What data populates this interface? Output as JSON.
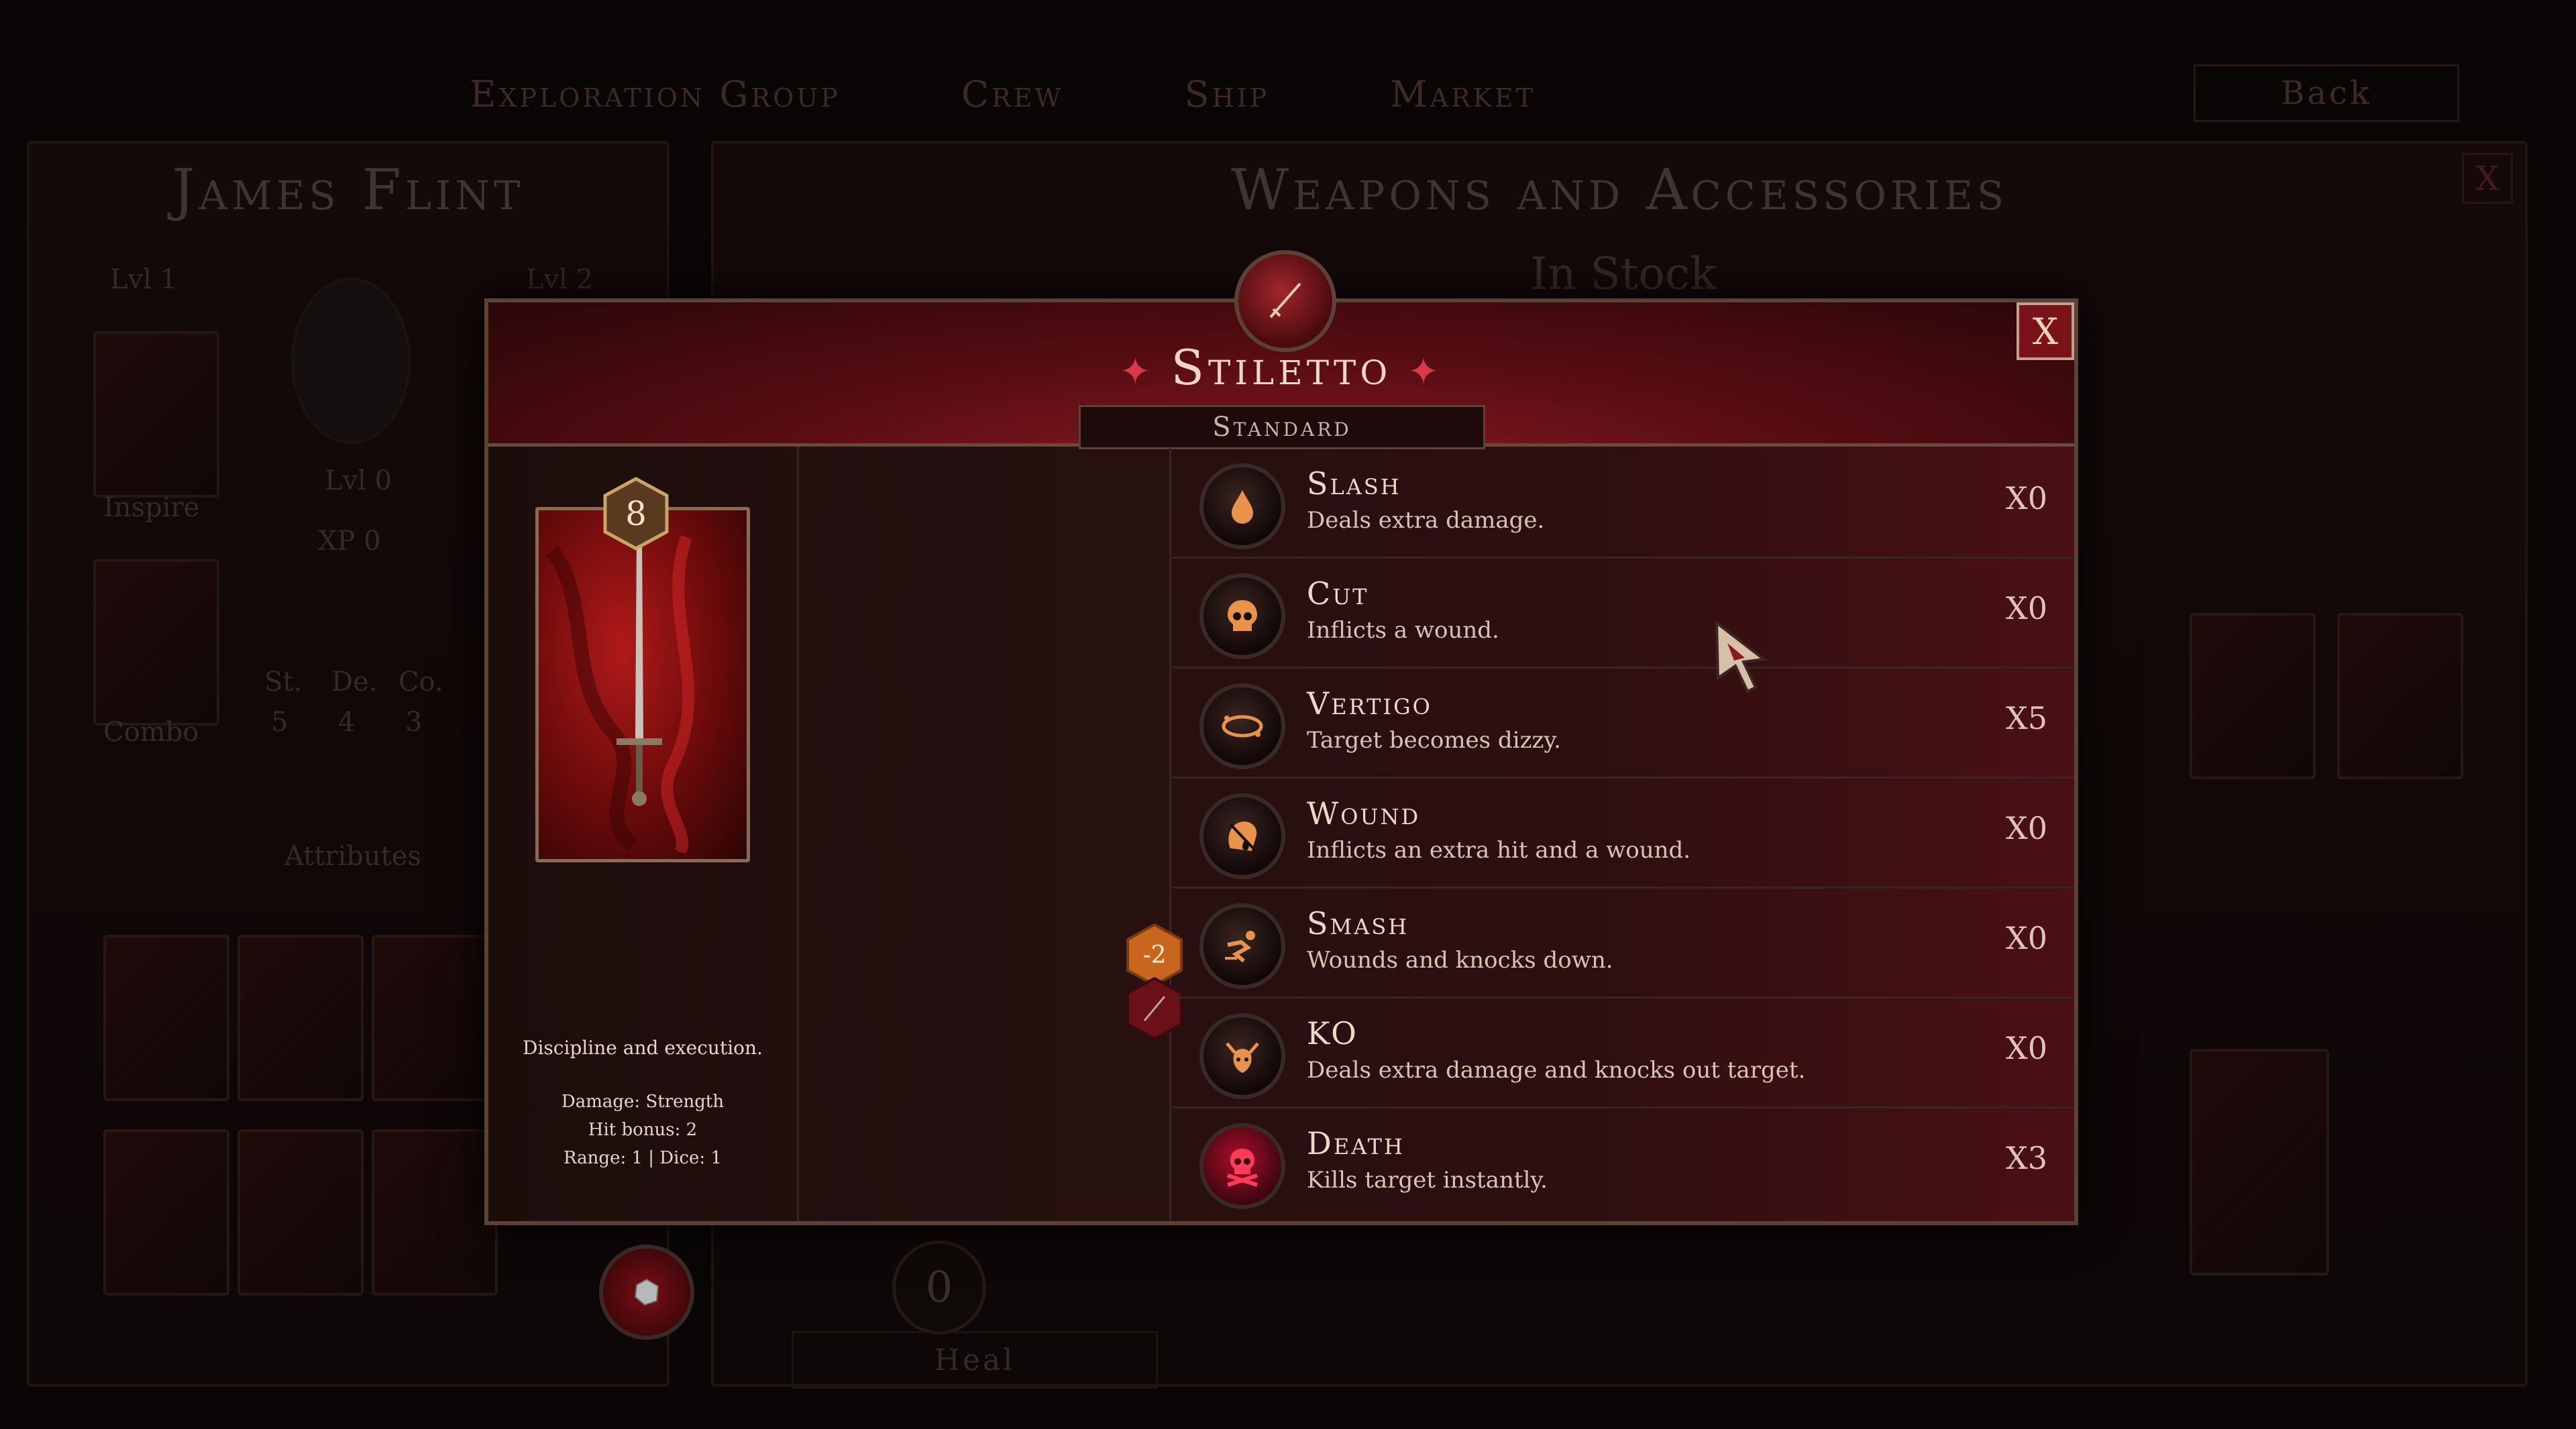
{
  "background": {
    "nav": [
      "Exploration Group",
      "Crew",
      "Ship",
      "Market"
    ],
    "back_label": "Back",
    "character_name": "James Flint",
    "left_lvl": "Lvl 1",
    "right_lvl": "Lvl 2",
    "lvl_box": "Lvl 0",
    "xp_box": "XP 0",
    "skill_inspire": "Inspire",
    "skill_combo": "Combo",
    "stat_labels": [
      "St.",
      "De.",
      "Co."
    ],
    "stat_values": [
      "5",
      "4",
      "3"
    ],
    "attributes_label": "Attributes",
    "weapons_title": "Weapons and Accessories",
    "in_stock": "In Stock",
    "counter": "0",
    "heal_label": "Heal",
    "close_label": "X"
  },
  "modal": {
    "title": "Stiletto",
    "rarity": "Standard",
    "close_label": "X",
    "card": {
      "cost": "8",
      "description": "Discipline and execution.",
      "damage": "Damage: Strength",
      "hit_bonus": "Hit bonus: 2",
      "range_dice": "Range: 1 | Dice: 1"
    },
    "modifier": "-2",
    "abilities": [
      {
        "name": "Slash",
        "desc": "Deals extra damage.",
        "mult": "X0",
        "icon": "blood-drop-icon"
      },
      {
        "name": "Cut",
        "desc": "Inflicts a wound.",
        "mult": "X0",
        "icon": "skull-icon"
      },
      {
        "name": "Vertigo",
        "desc": "Target becomes dizzy.",
        "mult": "X5",
        "icon": "dizzy-swirl-icon"
      },
      {
        "name": "Wound",
        "desc": "Inflicts an extra hit and a wound.",
        "mult": "X0",
        "icon": "wounded-head-icon"
      },
      {
        "name": "Smash",
        "desc": "Wounds and knocks down.",
        "mult": "X0",
        "icon": "falling-figure-icon"
      },
      {
        "name": "KO",
        "desc": "Deals extra damage and knocks out target.",
        "mult": "X0",
        "icon": "knockout-head-icon"
      },
      {
        "name": "Death",
        "desc": "Kills target instantly.",
        "mult": "X3",
        "icon": "skull-crossbones-icon"
      }
    ]
  },
  "colors": {
    "accent_red": "#d43a4a",
    "frame_bronze": "#8a6a52",
    "icon_orange": "#e8924a",
    "death_red": "#c0102a"
  }
}
